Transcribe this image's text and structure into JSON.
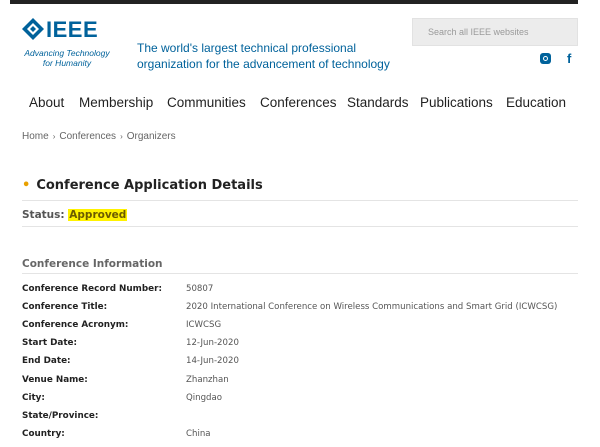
{
  "header": {
    "logo_word": "IEEE",
    "logo_tagline_1": "Advancing Technology",
    "logo_tagline_2": "for Humanity",
    "tagline": "The world's largest technical professional organization for the advancement of technology",
    "search_placeholder": "Search all IEEE websites",
    "social": [
      "instagram-icon",
      "facebook-icon"
    ],
    "facebook_glyph": "f"
  },
  "nav": {
    "items": [
      "About",
      "Membership",
      "Communities",
      "Conferences",
      "Standards",
      "Publications",
      "Education"
    ]
  },
  "breadcrumb": {
    "items": [
      "Home",
      "Conferences",
      "Organizers"
    ],
    "separator": "›"
  },
  "page": {
    "title": "Conference Application Details",
    "title_marker": "•",
    "status_label": "Status:",
    "status_value": "Approved"
  },
  "conference_info": {
    "section_title": "Conference Information",
    "rows": [
      {
        "label": "Conference Record Number:",
        "value": "50807"
      },
      {
        "label": "Conference Title:",
        "value": "2020 International Conference on Wireless Communications and Smart Grid (ICWCSG)"
      },
      {
        "label": "Conference Acronym:",
        "value": "ICWCSG"
      },
      {
        "label": "Start Date:",
        "value": "12-Jun-2020"
      },
      {
        "label": "End Date:",
        "value": "14-Jun-2020"
      },
      {
        "label": "Venue Name:",
        "value": "Zhanzhan"
      },
      {
        "label": "City:",
        "value": "Qingdao"
      },
      {
        "label": "State/Province:",
        "value": ""
      },
      {
        "label": "Country:",
        "value": "China"
      }
    ]
  },
  "colors": {
    "brand_blue": "#00629b",
    "highlight": "#fff200",
    "bullet": "#e8a000"
  }
}
